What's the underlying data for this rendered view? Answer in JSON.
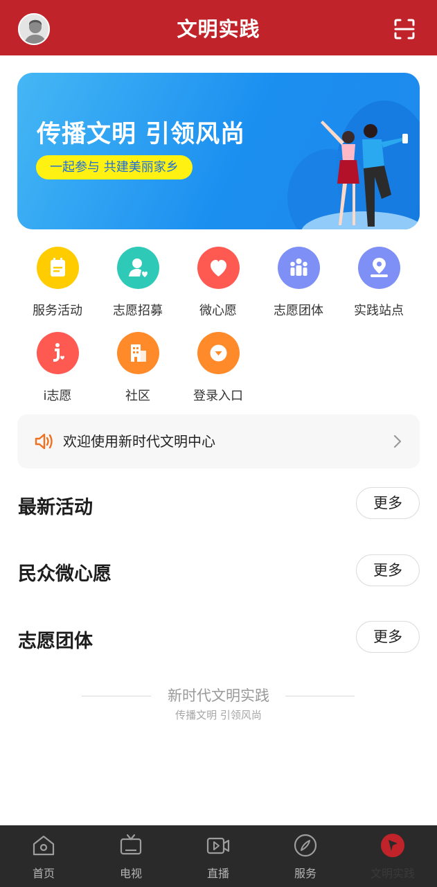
{
  "header": {
    "title": "文明实践"
  },
  "banner": {
    "title": "传播文明 引领风尚",
    "subtitle": "一起参与 共建美丽家乡"
  },
  "grid": [
    {
      "label": "服务活动",
      "color": "#ffcc00",
      "icon": "calendar-icon"
    },
    {
      "label": "志愿招募",
      "color": "#2fc9b8",
      "icon": "user-heart-icon"
    },
    {
      "label": "微心愿",
      "color": "#ff5a52",
      "icon": "heart-icon"
    },
    {
      "label": "志愿团体",
      "color": "#7e8ff6",
      "icon": "group-icon"
    },
    {
      "label": "实践站点",
      "color": "#7e8ff6",
      "icon": "map-pin-icon"
    },
    {
      "label": "i志愿",
      "color": "#ff5a52",
      "icon": "i-volunteer-icon"
    },
    {
      "label": "社区",
      "color": "#ff8a2a",
      "icon": "building-icon"
    },
    {
      "label": "登录入口",
      "color": "#ff8a2a",
      "icon": "login-icon"
    }
  ],
  "notice": {
    "text": "欢迎使用新时代文明中心"
  },
  "sections": [
    {
      "title": "最新活动",
      "more": "更多"
    },
    {
      "title": "民众微心愿",
      "more": "更多"
    },
    {
      "title": "志愿团体",
      "more": "更多"
    }
  ],
  "footer": {
    "title": "新时代文明实践",
    "subtitle": "传播文明 引领风尚"
  },
  "tabs": [
    {
      "label": "首页",
      "icon": "home-icon"
    },
    {
      "label": "电视",
      "icon": "tv-icon"
    },
    {
      "label": "直播",
      "icon": "video-icon"
    },
    {
      "label": "服务",
      "icon": "compass-icon"
    },
    {
      "label": "文明实践",
      "icon": "flag-icon",
      "active": true
    }
  ],
  "colors": {
    "brand": "#c0242a",
    "tabbar": "#2a2a2a"
  }
}
